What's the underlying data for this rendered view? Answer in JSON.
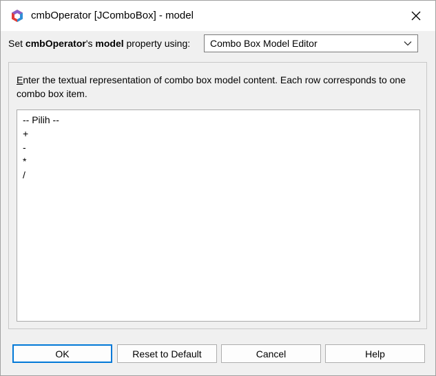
{
  "window": {
    "title": "cmbOperator [JComboBox] - model"
  },
  "property_row": {
    "prefix": "Set ",
    "component": "cmbOperator",
    "possessive": "'s ",
    "property": "model",
    "suffix": " property using:",
    "editor_selected": "Combo Box Model Editor"
  },
  "panel": {
    "instruction_mnemonic": "E",
    "instruction_rest": "nter the textual representation of combo box model content. Each row corresponds to one combo box item.",
    "items": [
      "-- Pilih --",
      "+",
      "-",
      "*",
      "/"
    ]
  },
  "buttons": {
    "ok": "OK",
    "reset": "Reset to Default",
    "cancel": "Cancel",
    "help": "Help"
  },
  "colors": {
    "default_button_border": "#0078d7",
    "window_background": "#f0f0f0"
  },
  "icons": {
    "app": "netbeans-cube-icon",
    "close": "close-icon",
    "dropdown": "chevron-down-icon"
  }
}
